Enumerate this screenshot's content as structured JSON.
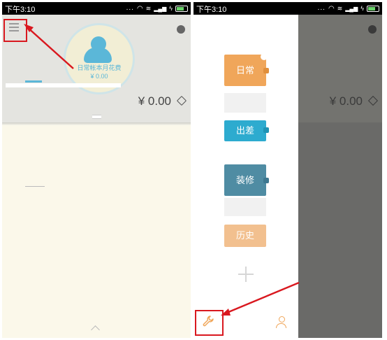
{
  "status_bar": {
    "time": "下午3:10",
    "signal_dots": "..."
  },
  "left_screen": {
    "circle_label": "日常帐本月花费",
    "circle_value": "¥ 0.00",
    "total_amount": "¥ 0.00",
    "icons": [
      "menu-icon",
      "pie-chart-icon",
      "tag-icon",
      "chevron-up-icon"
    ]
  },
  "right_screen": {
    "books": [
      {
        "label": "日常",
        "color": "#f0a65a"
      },
      {
        "label": "出差",
        "color": "#2dabcf"
      },
      {
        "label": "装修",
        "color": "#4f8ca3"
      },
      {
        "label": "历史",
        "color": "#f2c08f"
      }
    ],
    "total_amount": "¥ 0.00",
    "icons": [
      "plus-icon",
      "wrench-icon",
      "user-icon"
    ]
  },
  "colors": {
    "annotation_red": "#d9181f",
    "header_bg": "#e4e4e0",
    "content_bg": "#fbf8ea",
    "accent_blue": "#5bb7d8"
  }
}
